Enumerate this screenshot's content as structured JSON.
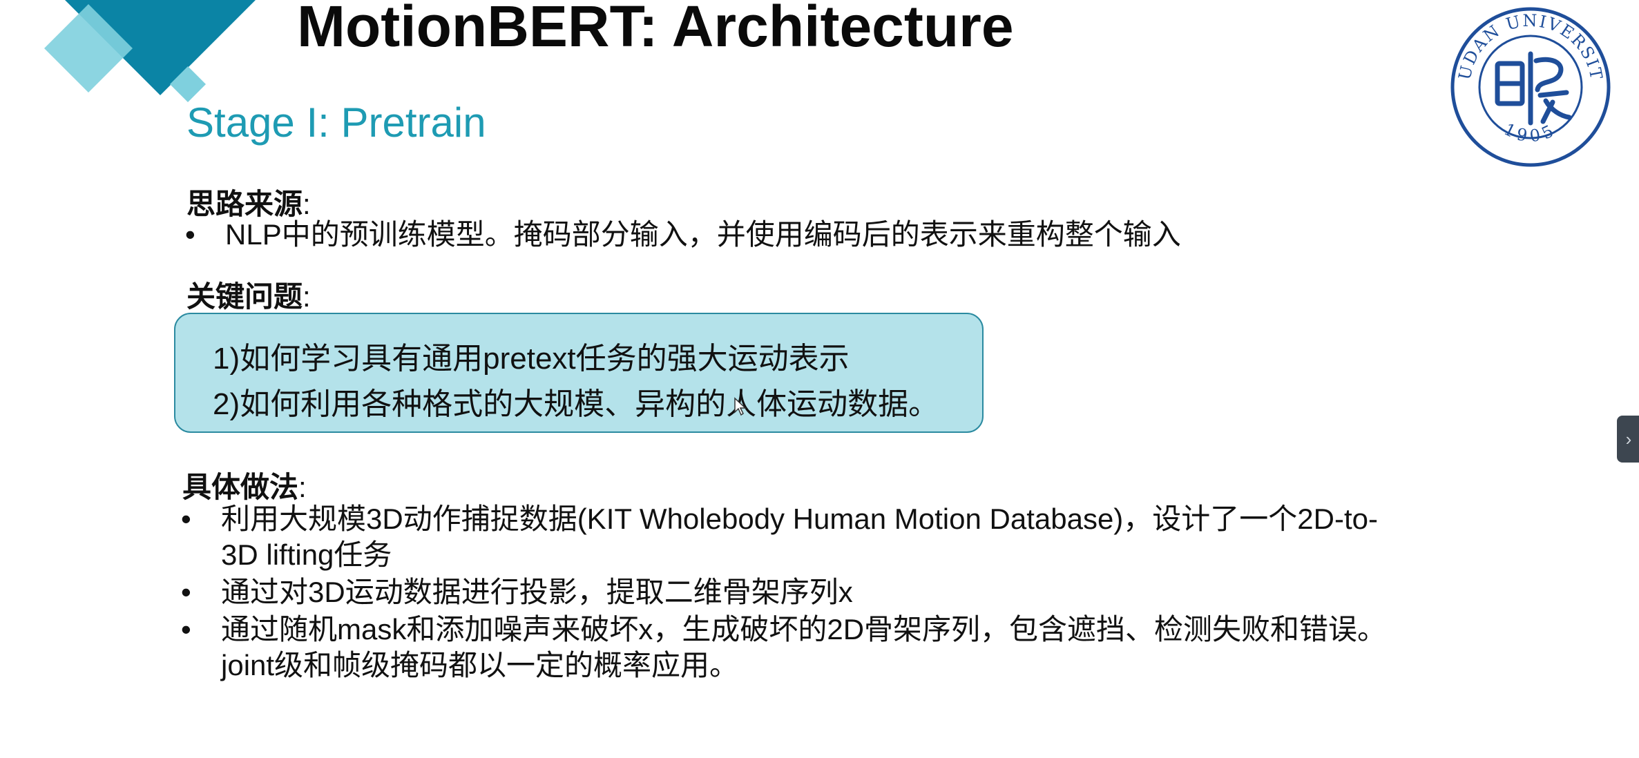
{
  "slide": {
    "title": "MotionBERT: Architecture",
    "subtitle": "Stage I: Pretrain",
    "seal": {
      "text_top": "FUDAN UNIVERSITY",
      "text_bottom": "1905"
    },
    "sections": {
      "idea_source": {
        "heading": "思路来源",
        "colon": ":",
        "bullets": [
          "NLP中的预训练模型。掩码部分输入，并使用编码后的表示来重构整个输入"
        ]
      },
      "key_questions": {
        "heading": "关键问题",
        "colon": ":",
        "items": [
          "1)如何学习具有通用pretext任务的强大运动表示",
          "2)如何利用各种格式的大规模、异构的人体运动数据。"
        ]
      },
      "method": {
        "heading": "具体做法",
        "colon": ":",
        "bullets": [
          {
            "lines": [
              "利用大规模3D动作捕捉数据(KIT Wholebody Human Motion Database)，设计了一个2D-to-",
              "3D lifting任务"
            ]
          },
          {
            "lines": [
              "通过对3D运动数据进行投影，提取二维骨架序列x"
            ]
          },
          {
            "lines": [
              "通过随机mask和添加噪声来破坏x，生成破坏的2D骨架序列，包含遮挡、检测失败和错误。",
              "joint级和帧级掩码都以一定的概率应用。"
            ]
          }
        ]
      }
    },
    "bullet_glyph": "•",
    "sidebar_toggle_glyph": "›",
    "colors": {
      "accent": "#1e9bb3",
      "box_fill": "#b4e2ea",
      "box_border": "#2a8aa0",
      "deco_dark": "#0b84a5",
      "deco_light": "#7fd0de",
      "seal_blue": "#1f4e9a"
    }
  }
}
